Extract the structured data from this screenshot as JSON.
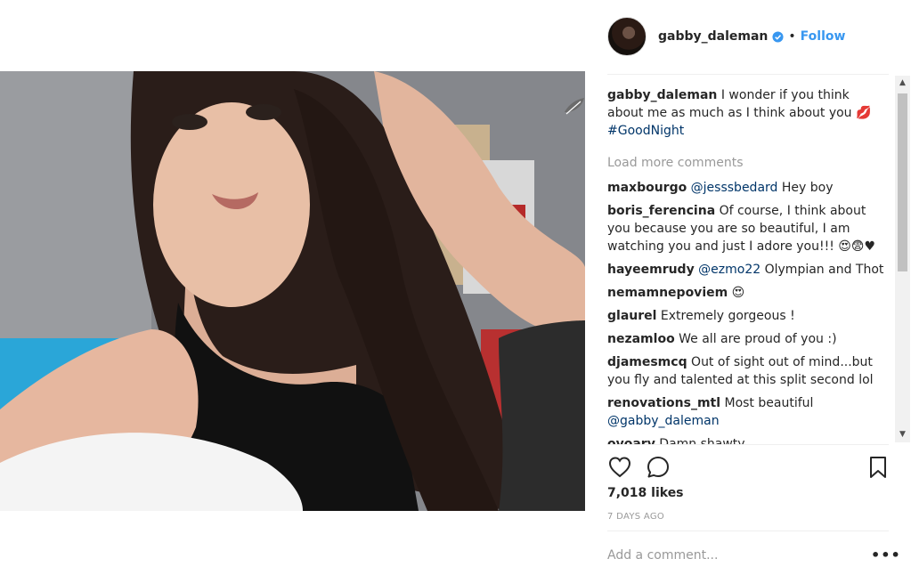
{
  "post": {
    "username": "gabby_daleman",
    "dot": "•",
    "follow_label": "Follow",
    "caption_user": "gabby_daleman",
    "caption_text": " I wonder if you think about me as much as I think about you 💋 ",
    "caption_tag": "#GoodNight",
    "load_more": "Load more comments",
    "comments": [
      {
        "user": "maxbourgo",
        "mention": "@jesssbedard",
        "text": " Hey boy"
      },
      {
        "user": "boris_ferencina",
        "mention": "",
        "text": " Of course, I think about you because you are so beautiful, I am watching you and just I adore you!!! 😍😨♥"
      },
      {
        "user": "hayeemrudy",
        "mention": "@ezmo22",
        "text": " Olympian and Thot"
      },
      {
        "user": "nemamnepoviem",
        "mention": "",
        "text": " 😍"
      },
      {
        "user": "glaurel",
        "mention": "",
        "text": " Extremely gorgeous !"
      },
      {
        "user": "nezamloo",
        "mention": "",
        "text": " We all are proud of you :)"
      },
      {
        "user": "djamesmcq",
        "mention": "",
        "text": " Out of sight out of mind...but you fly and talented at this split second lol"
      },
      {
        "user": "renovations_mtl",
        "mention": "",
        "text": " Most beautiful "
      },
      {
        "user": "ovoarv",
        "mention": "",
        "text": " Damn shawty"
      }
    ],
    "renovations_mention": "@gabby_daleman",
    "likes": "7,018 likes",
    "age": "7 DAYS AGO",
    "add_comment_placeholder": "Add a comment...",
    "more_label": "•••"
  },
  "scrollbar": {
    "up": "▲",
    "down": "▼"
  },
  "icons": {
    "heart": "heart-icon",
    "comment": "comment-bubble-icon",
    "bookmark": "bookmark-icon",
    "verified": "verified-badge-icon",
    "more": "more-options-icon"
  },
  "colors": {
    "accent": "#3897f0",
    "verified": "#3897f0",
    "muted": "#999999",
    "link": "#003569"
  }
}
